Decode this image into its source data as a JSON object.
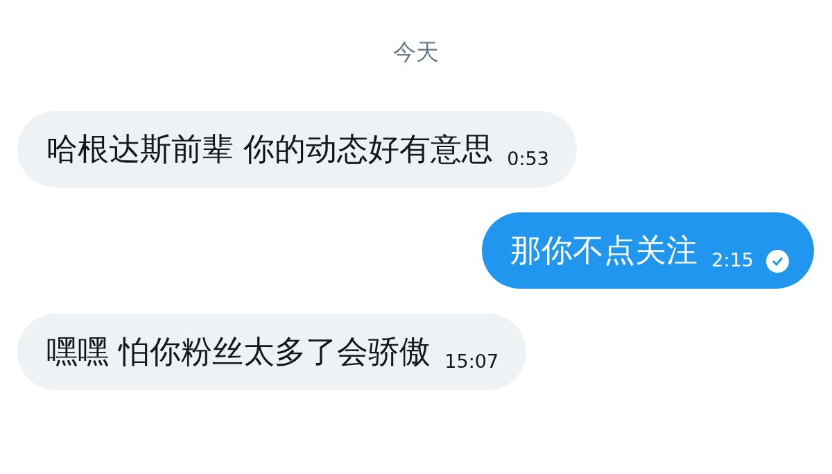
{
  "date_divider": "今天",
  "messages": [
    {
      "kind": "received",
      "text": "哈根达斯前辈 你的动态好有意思",
      "time": "0:53",
      "read": false
    },
    {
      "kind": "sent",
      "text": "那你不点关注",
      "time": "2:15",
      "read": true
    },
    {
      "kind": "received",
      "text": "嘿嘿 怕你粉丝太多了会骄傲",
      "time": "15:07",
      "read": false
    }
  ]
}
